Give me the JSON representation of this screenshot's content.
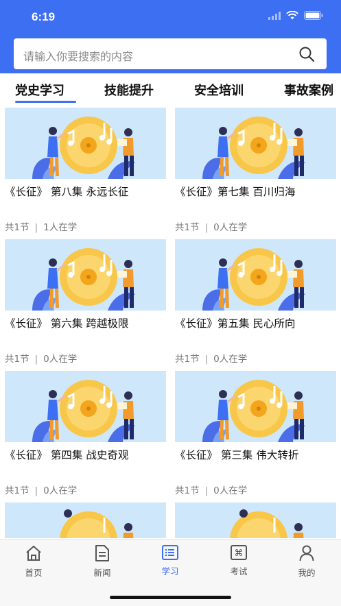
{
  "status": {
    "time": "6:19"
  },
  "search": {
    "placeholder": "请输入你要搜索的内容"
  },
  "tabs": [
    {
      "label": "党史学习"
    },
    {
      "label": "技能提升"
    },
    {
      "label": "安全培训"
    },
    {
      "label": "事故案例"
    }
  ],
  "courses": [
    {
      "title": "《长征》 第八集 永远长征",
      "lessons": "共1节",
      "learners": "1人在学"
    },
    {
      "title": "《长征》第七集 百川归海",
      "lessons": "共1节",
      "learners": "0人在学"
    },
    {
      "title": "《长征》 第六集 跨越极限",
      "lessons": "共1节",
      "learners": "0人在学"
    },
    {
      "title": "《长征》第五集 民心所向",
      "lessons": "共1节",
      "learners": "0人在学"
    },
    {
      "title": "《长征》 第四集 战史奇观",
      "lessons": "共1节",
      "learners": "0人在学"
    },
    {
      "title": "《长征》 第三集 伟大转折",
      "lessons": "共1节",
      "learners": "0人在学"
    }
  ],
  "tabbar": [
    {
      "label": "首页",
      "icon": "home-icon"
    },
    {
      "label": "新闻",
      "icon": "news-icon"
    },
    {
      "label": "学习",
      "icon": "study-icon"
    },
    {
      "label": "考试",
      "icon": "exam-icon"
    },
    {
      "label": "我的",
      "icon": "profile-icon"
    }
  ],
  "colors": {
    "accent": "#3d6ff2",
    "thumb_bg": "#cfe7fb"
  }
}
